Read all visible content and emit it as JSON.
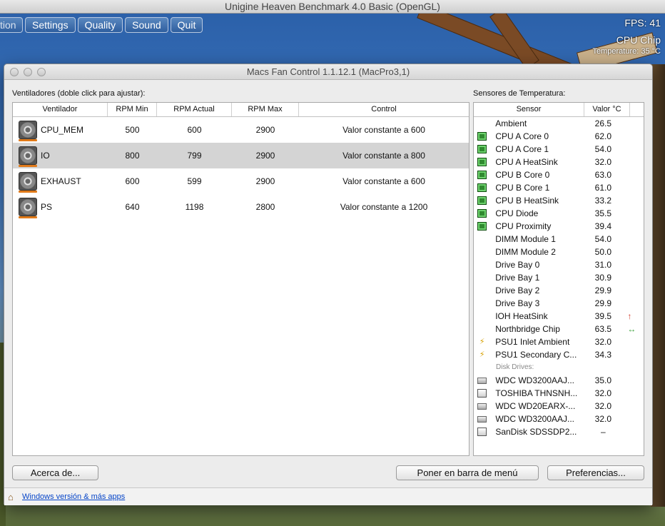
{
  "bench": {
    "title": "Unigine Heaven Benchmark 4.0 Basic (OpenGL)",
    "menu": [
      "tion",
      "Settings",
      "Quality",
      "Sound",
      "Quit"
    ],
    "fps": "FPS: 41",
    "chip": "CPU Chip",
    "temp": "Temperature: 35 °C"
  },
  "window": {
    "title": "Macs Fan Control 1.1.12.1 (MacPro3,1)",
    "fans_label": "Ventiladores (doble click para ajustar):",
    "sensors_label": "Sensores de Temperatura:"
  },
  "fans_table": {
    "headers": [
      "Ventilador",
      "RPM Min",
      "RPM Actual",
      "RPM Max",
      "Control"
    ],
    "rows": [
      {
        "name": "CPU_MEM",
        "min": "500",
        "actual": "600",
        "max": "2900",
        "control": "Valor constante a 600"
      },
      {
        "name": "IO",
        "min": "800",
        "actual": "799",
        "max": "2900",
        "control": "Valor constante a 800"
      },
      {
        "name": "EXHAUST",
        "min": "600",
        "actual": "599",
        "max": "2900",
        "control": "Valor constante a 600"
      },
      {
        "name": "PS",
        "min": "640",
        "actual": "1198",
        "max": "2800",
        "control": "Valor constante a 1200"
      }
    ]
  },
  "sensors_table": {
    "headers": [
      "Sensor",
      "Valor °C"
    ],
    "rows": [
      {
        "icon": "none",
        "name": "Ambient",
        "value": "26.5",
        "trend": ""
      },
      {
        "icon": "chip-icon",
        "name": "CPU A Core 0",
        "value": "62.0",
        "trend": ""
      },
      {
        "icon": "chip-icon",
        "name": "CPU A Core 1",
        "value": "54.0",
        "trend": ""
      },
      {
        "icon": "chip-icon",
        "name": "CPU A HeatSink",
        "value": "32.0",
        "trend": ""
      },
      {
        "icon": "chip-icon",
        "name": "CPU B Core 0",
        "value": "63.0",
        "trend": ""
      },
      {
        "icon": "chip-icon",
        "name": "CPU B Core 1",
        "value": "61.0",
        "trend": ""
      },
      {
        "icon": "chip-icon",
        "name": "CPU B HeatSink",
        "value": "33.2",
        "trend": ""
      },
      {
        "icon": "chip-icon",
        "name": "CPU Diode",
        "value": "35.5",
        "trend": ""
      },
      {
        "icon": "chip-icon",
        "name": "CPU Proximity",
        "value": "39.4",
        "trend": ""
      },
      {
        "icon": "none",
        "name": "DIMM Module 1",
        "value": "54.0",
        "trend": ""
      },
      {
        "icon": "none",
        "name": "DIMM Module 2",
        "value": "50.0",
        "trend": ""
      },
      {
        "icon": "none",
        "name": "Drive Bay 0",
        "value": "31.0",
        "trend": ""
      },
      {
        "icon": "none",
        "name": "Drive Bay 1",
        "value": "30.9",
        "trend": ""
      },
      {
        "icon": "none",
        "name": "Drive Bay 2",
        "value": "29.9",
        "trend": ""
      },
      {
        "icon": "none",
        "name": "Drive Bay 3",
        "value": "29.9",
        "trend": ""
      },
      {
        "icon": "none",
        "name": "IOH HeatSink",
        "value": "39.5",
        "trend": "up"
      },
      {
        "icon": "none",
        "name": "Northbridge Chip",
        "value": "63.5",
        "trend": "steady"
      },
      {
        "icon": "power-icon",
        "name": "PSU1 Inlet Ambient",
        "value": "32.0",
        "trend": ""
      },
      {
        "icon": "power-icon",
        "name": "PSU1 Secondary C...",
        "value": "34.3",
        "trend": ""
      }
    ],
    "disk_group_label": "Disk Drives:",
    "disks": [
      {
        "icon": "hdd-icon",
        "name": "WDC WD3200AAJ...",
        "value": "35.0"
      },
      {
        "icon": "ssd-icon",
        "name": "TOSHIBA THNSNH...",
        "value": "32.0"
      },
      {
        "icon": "hdd-icon",
        "name": "WDC WD20EARX-...",
        "value": "32.0"
      },
      {
        "icon": "hdd-icon",
        "name": "WDC WD3200AAJ...",
        "value": "32.0"
      },
      {
        "icon": "ssd-icon",
        "name": "SanDisk SDSSDP2...",
        "value": "–"
      }
    ]
  },
  "buttons": {
    "about": "Acerca de...",
    "menubar": "Poner en barra de menú",
    "prefs": "Preferencias..."
  },
  "footer": {
    "link": "Windows versión & más apps"
  },
  "colors": {
    "selected_row": "#d4d4d4",
    "trend_up": "#d03a2a",
    "trend_steady": "#3aa03a",
    "link": "#0645c8"
  }
}
